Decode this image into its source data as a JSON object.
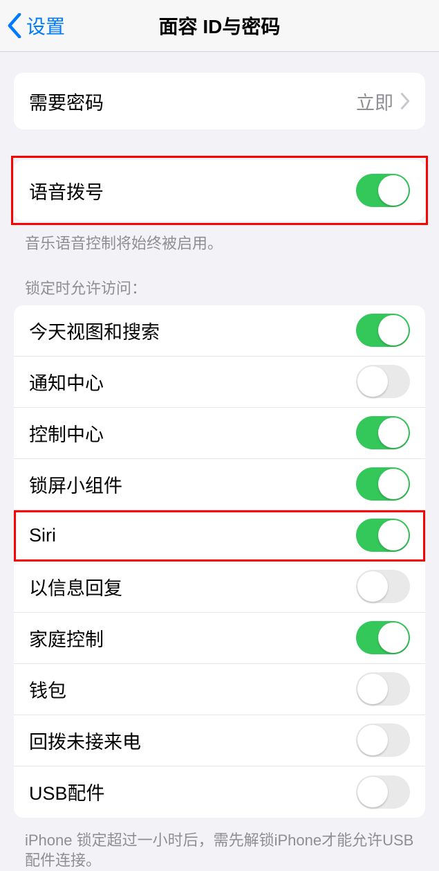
{
  "nav": {
    "back_label": "设置",
    "title": "面容 ID与密码"
  },
  "passcode_row": {
    "label": "需要密码",
    "value": "立即"
  },
  "voice_dial": {
    "label": "语音拨号",
    "on": true,
    "footer": "音乐语音控制将始终被启用。"
  },
  "lock_header": "锁定时允许访问：",
  "lock_items": [
    {
      "label": "今天视图和搜索",
      "on": true
    },
    {
      "label": "通知中心",
      "on": false
    },
    {
      "label": "控制中心",
      "on": true
    },
    {
      "label": "锁屏小组件",
      "on": true
    },
    {
      "label": "Siri",
      "on": true
    },
    {
      "label": "以信息回复",
      "on": false
    },
    {
      "label": "家庭控制",
      "on": true
    },
    {
      "label": "钱包",
      "on": false
    },
    {
      "label": "回拨未接来电",
      "on": false
    },
    {
      "label": "USB配件",
      "on": false
    }
  ],
  "usb_footer": "iPhone 锁定超过一小时后，需先解锁iPhone才能允许USB 配件连接。",
  "highlighted": [
    0,
    4
  ]
}
